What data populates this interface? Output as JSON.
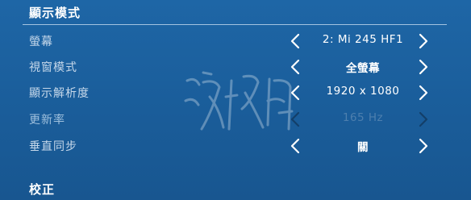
{
  "header": {
    "title": "顯示模式"
  },
  "settings": [
    {
      "label": "螢幕",
      "value": "2: Mi 245 HF1",
      "enabled": true
    },
    {
      "label": "視窗模式",
      "value": "全螢幕",
      "enabled": true
    },
    {
      "label": "顯示解析度",
      "value": "1920 x 1080",
      "enabled": true
    },
    {
      "label": "更新率",
      "value": "165 Hz",
      "enabled": false
    },
    {
      "label": "垂直同步",
      "value": "關",
      "enabled": true
    }
  ],
  "footer_section": {
    "title": "校正"
  },
  "icons": {
    "prev": "chevron-left-icon",
    "next": "chevron-right-icon"
  },
  "colors": {
    "background": "#1b5f9c",
    "text": "#ffffff",
    "label": "#c6d8ea",
    "disabled_value": "#4d7fae"
  }
}
